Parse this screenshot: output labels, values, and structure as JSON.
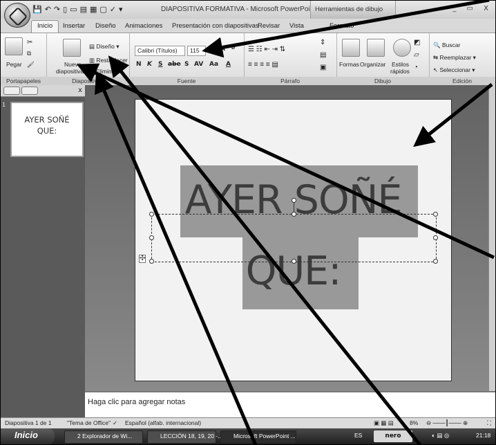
{
  "window": {
    "title": "DIAPOSITIVA FORMATIVA - Microsoft PowerPoint",
    "context_tab": "Herramientas de dibujo",
    "controls": "_ ▭ X"
  },
  "tabs": [
    "Inicio",
    "Insertar",
    "Diseño",
    "Animaciones",
    "Presentación con diapositivas",
    "Revisar",
    "Vista",
    "Formato"
  ],
  "ribbon": {
    "portapapeles": {
      "paste": "Pegar",
      "label": "Portapapeles"
    },
    "diapositivas": {
      "new_slide_1": "Nueva",
      "new_slide_2": "diapositiva",
      "design": "Diseño",
      "reset": "Restablecer",
      "delete": "Eliminar",
      "label": "Diapositivas"
    },
    "fuente": {
      "font_name": "Calibri (Títulos)",
      "font_size": "115",
      "label": "Fuente"
    },
    "parrafo": {
      "label": "Párrafo"
    },
    "dibujo": {
      "shapes": "Formas",
      "arrange": "Organizar",
      "quick_styles_1": "Estilos",
      "quick_styles_2": "rápidos",
      "label": "Dibujo"
    },
    "edicion": {
      "find": "Buscar",
      "replace": "Reemplazar",
      "select": "Seleccionar",
      "label": "Edición"
    }
  },
  "slides_panel": {
    "slide_number": "1",
    "thumbnail_text_1": "AYER SOÑÉ",
    "thumbnail_text_2": "QUE:"
  },
  "slide": {
    "title_line_1": "AYER SOÑÉ",
    "title_line_2": "QUE:"
  },
  "notes_placeholder": "Haga clic para agregar notas",
  "status_bar": {
    "slide_info": "Diapositiva 1 de 1",
    "theme": "\"Tema de Office\"",
    "language": "Español (alfab. internacional)",
    "zoom": "8%"
  },
  "taskbar": {
    "start": "Inicio",
    "tasks": [
      "2 Explorador de Wi...",
      "LECCIÓN 18, 19, 20 -...",
      "Microsoft PowerPoint ..."
    ],
    "lang": "ES",
    "nero": "nero",
    "clock": "21:18"
  }
}
